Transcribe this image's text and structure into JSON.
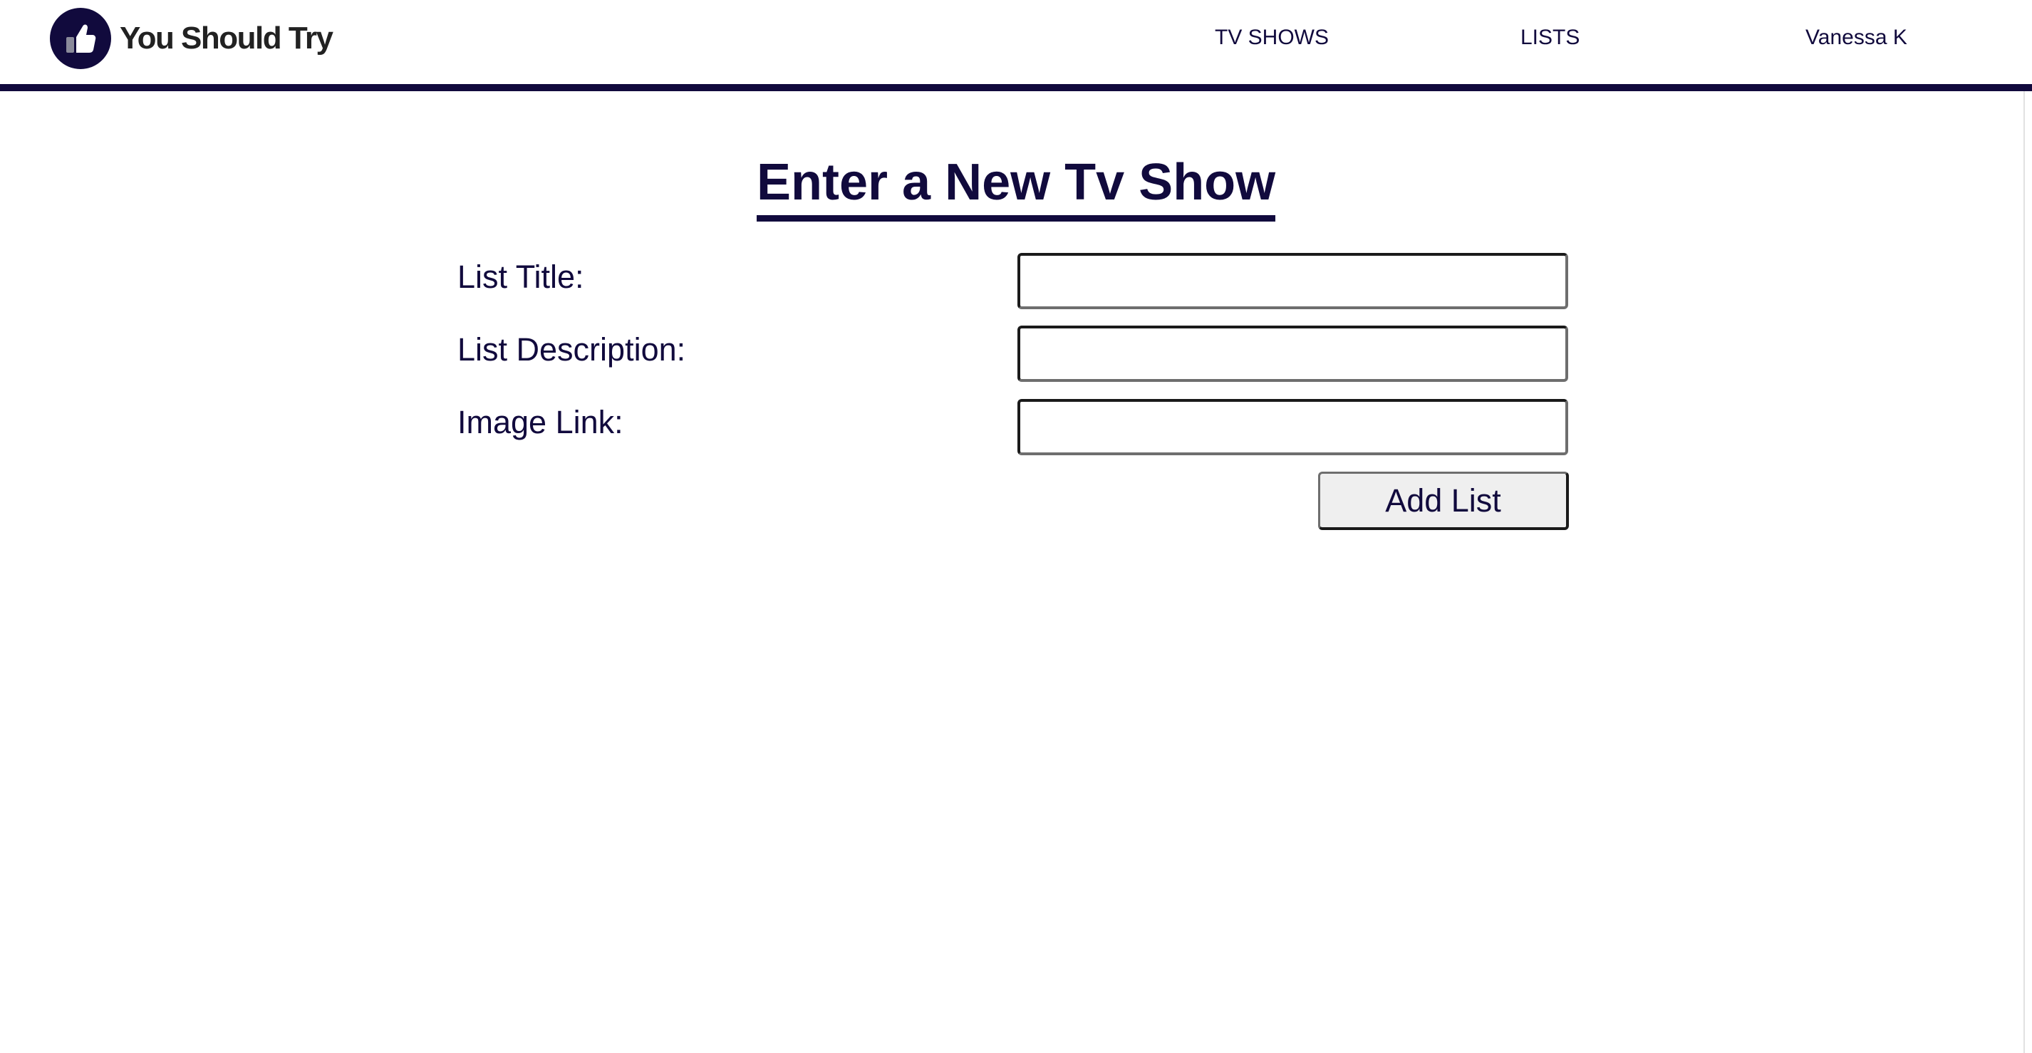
{
  "header": {
    "brand_name": "You Should Try",
    "logo_icon": "thumbs-up-icon",
    "nav": {
      "tv_shows": "TV SHOWS",
      "lists": "LISTS",
      "user": "Vanessa K"
    }
  },
  "form": {
    "title": "Enter a New Tv Show",
    "fields": [
      {
        "label": "List Title:",
        "value": "",
        "placeholder": ""
      },
      {
        "label": "List Description:",
        "value": "",
        "placeholder": ""
      },
      {
        "label": "Image Link:",
        "value": "",
        "placeholder": ""
      }
    ],
    "submit_label": "Add List"
  },
  "colors": {
    "brand_navy": "#110a3d",
    "button_bg": "#efefef",
    "background": "#ffffff"
  }
}
